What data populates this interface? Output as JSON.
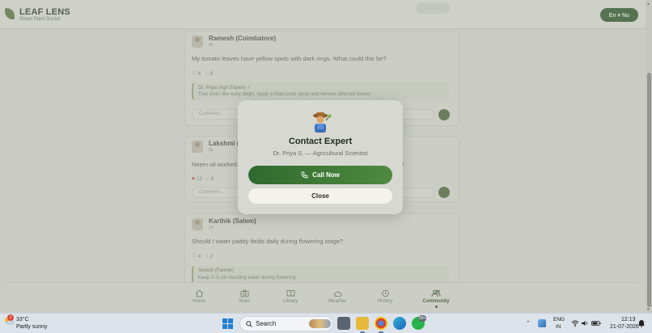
{
  "app": {
    "brand": "LEAF LENS",
    "tagline": "Smart Plant Doctor",
    "header_button": "En ▾ Nu"
  },
  "posts": [
    {
      "author": "Ramesh (Coimbatore)",
      "time": "2h",
      "text": "My tomato leaves have yellow spots with dark rings. What could this be?",
      "likes": "4",
      "comments": "3",
      "reply_title": "Dr. Priya (Agri Expert) ✓",
      "reply_body": "That looks like early blight. Apply a Mancozeb spray and remove affected leaves.",
      "comment_placeholder": "Comment..."
    },
    {
      "author": "Lakshmi (Madurai)",
      "time": "5h",
      "text": "Neem oil worked wonders on my chilli plants — aphids are gone within a week!",
      "likes": "12",
      "comments": "6",
      "comment_placeholder": "Comment..."
    },
    {
      "author": "Karthik (Salem)",
      "time": "1d",
      "text": "Should I water paddy fields daily during flowering stage?",
      "likes": "4",
      "comments": "2",
      "reply_title": "Suresh (Farmer)",
      "reply_body": "Keep 2–5 cm standing water during flowering."
    }
  ],
  "nav": {
    "items": [
      {
        "label": "Home",
        "icon": "home-icon"
      },
      {
        "label": "Scan",
        "icon": "camera-icon"
      },
      {
        "label": "Library",
        "icon": "book-icon"
      },
      {
        "label": "Weather",
        "icon": "cloud-icon"
      },
      {
        "label": "History",
        "icon": "history-icon"
      },
      {
        "label": "Community",
        "icon": "community-icon"
      }
    ],
    "active": "Community"
  },
  "modal": {
    "icon": "farmer-icon",
    "title": "Contact Expert",
    "subtitle": "Dr. Priya S. — Agricultural Scientist",
    "call_label": "Call Now",
    "close_label": "Close"
  },
  "taskbar": {
    "temperature": "33°C",
    "condition": "Partly sunny",
    "weather_badge": "1",
    "search": "Search",
    "language_line1": "ENG",
    "language_line2": "IN",
    "time": "12:13",
    "date": "21-07-2026",
    "whatsapp_badge": "99+"
  },
  "colors": {
    "primary_green": "#2f6a2f",
    "primary_green_light": "#4f8a3f",
    "modal_bg": "#d7d8d2",
    "close_bg": "#f3f2ec"
  }
}
